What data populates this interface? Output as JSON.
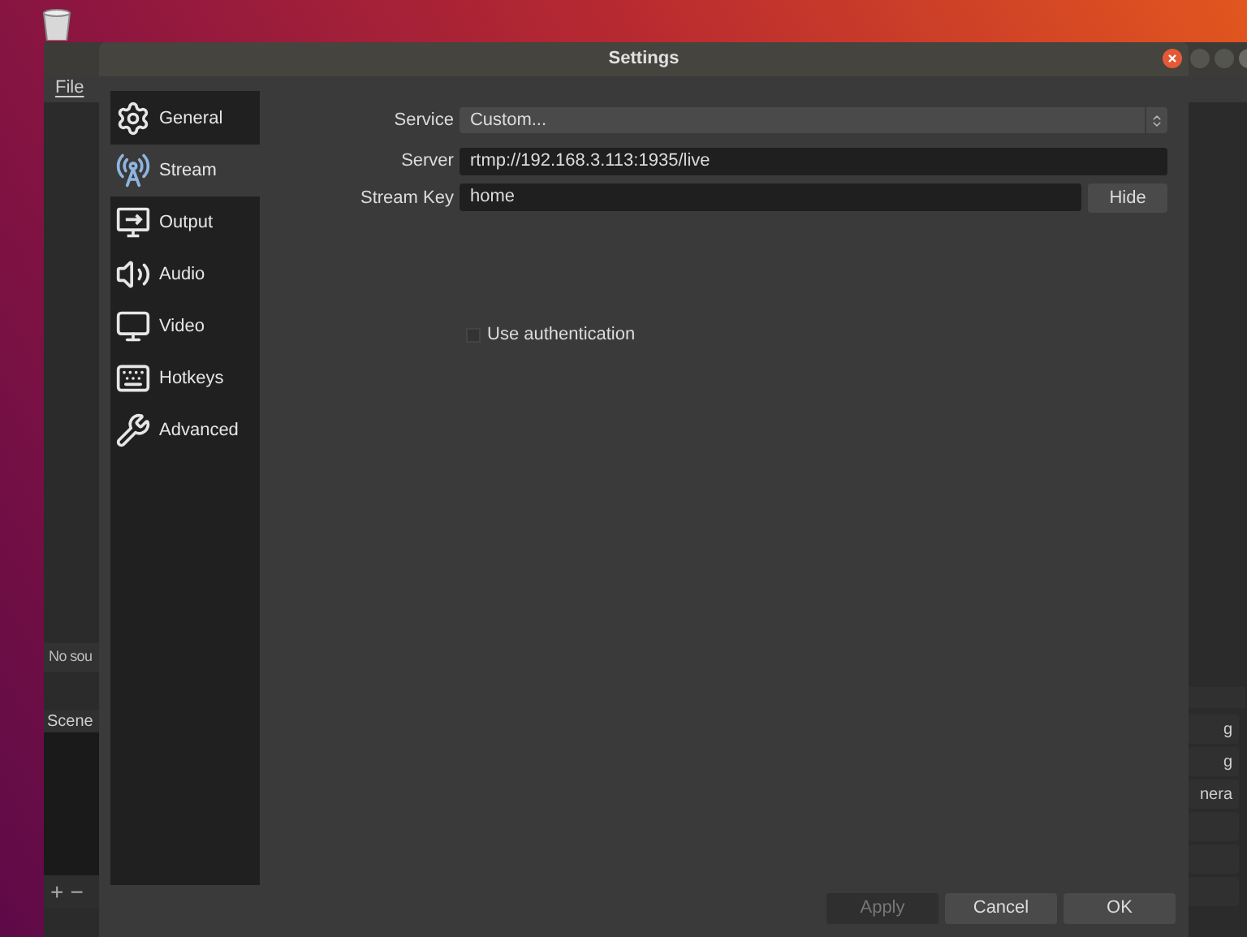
{
  "main_window": {
    "menu": [
      "File"
    ],
    "sources_empty": "No sou",
    "scenes_header": "Scene",
    "scene_buttons": [
      "+",
      "−"
    ],
    "right_items": [
      "g",
      "g",
      "nera"
    ]
  },
  "settings": {
    "title": "Settings",
    "nav": [
      {
        "label": "General",
        "kind": "gear",
        "selected": false
      },
      {
        "label": "Stream",
        "kind": "tower",
        "selected": true
      },
      {
        "label": "Output",
        "kind": "output",
        "selected": false
      },
      {
        "label": "Audio",
        "kind": "audio",
        "selected": false
      },
      {
        "label": "Video",
        "kind": "video",
        "selected": false
      },
      {
        "label": "Hotkeys",
        "kind": "keyboard",
        "selected": false
      },
      {
        "label": "Advanced",
        "kind": "tools",
        "selected": false
      }
    ],
    "service": {
      "label": "Service",
      "value": "Custom..."
    },
    "server": {
      "label": "Server",
      "value": "rtmp://192.168.3.113:1935/live"
    },
    "stream_key": {
      "label": "Stream Key",
      "value": "home",
      "button": "Hide"
    },
    "auth": {
      "label": "Use authentication",
      "checked": false
    },
    "buttons": [
      {
        "label": "Apply",
        "disabled": true
      },
      {
        "label": "Cancel",
        "disabled": false
      },
      {
        "label": "OK",
        "disabled": false
      }
    ]
  }
}
